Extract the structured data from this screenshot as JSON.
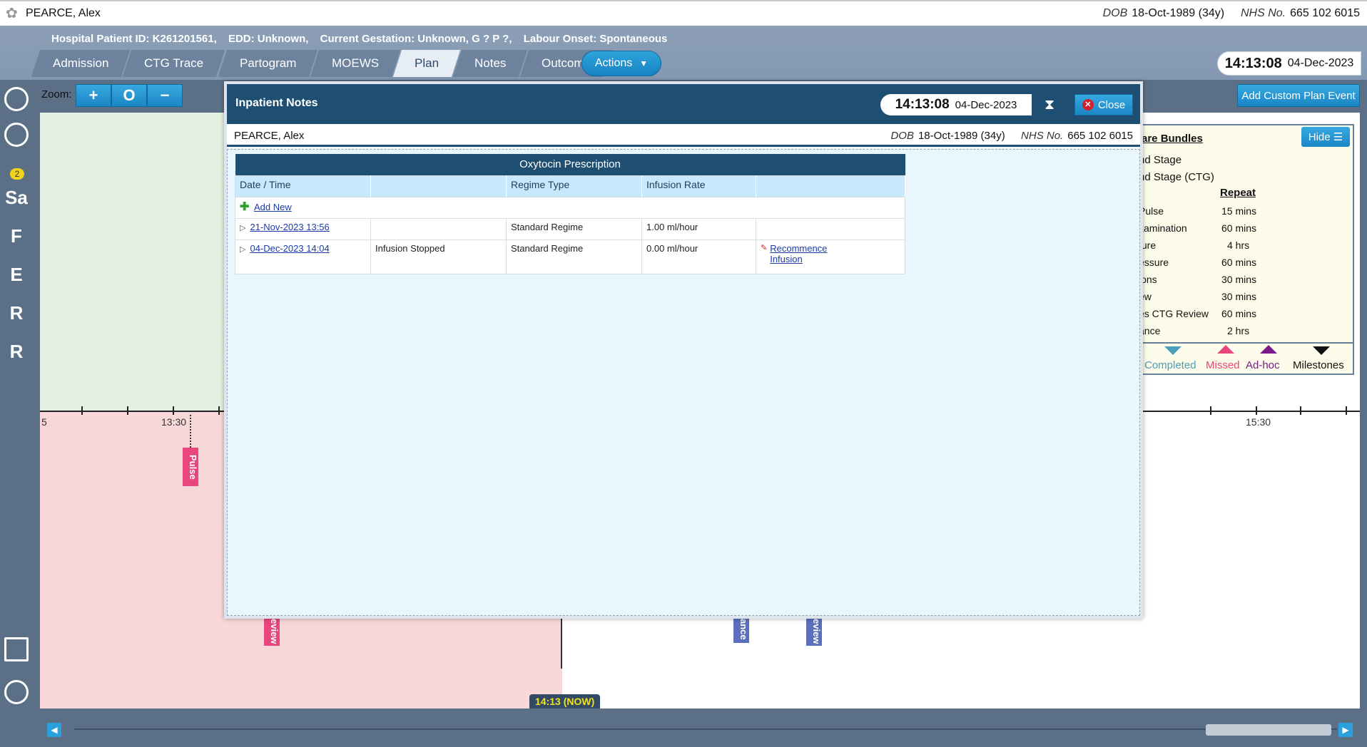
{
  "patient": {
    "name": "PEARCE, Alex",
    "dob_label": "DOB",
    "dob": "18-Oct-1989 (34y)",
    "nhs_label": "NHS No.",
    "nhs": "665 102 6015"
  },
  "header_info": {
    "hospital_id": "Hospital Patient ID: K261201561,",
    "edd": "EDD: Unknown,",
    "gestation": "Current Gestation: Unknown, G ? P ?,",
    "labour": "Labour Onset: Spontaneous"
  },
  "tabs": [
    {
      "label": "Admission"
    },
    {
      "label": "CTG Trace"
    },
    {
      "label": "Partogram"
    },
    {
      "label": "MOEWS"
    },
    {
      "label": "Plan"
    },
    {
      "label": "Notes"
    },
    {
      "label": "Outcome"
    }
  ],
  "actions_label": "Actions",
  "clock": {
    "time": "14:13:08",
    "date": "04-Dec-2023"
  },
  "rail": {
    "badge": "2",
    "letters": [
      "Sa",
      "F",
      "E",
      "R",
      "R"
    ]
  },
  "toolbar": {
    "zoom_label": "Zoom:",
    "zoom_in": "+",
    "zoom_reset": "O",
    "zoom_out": "−",
    "add_custom": "Add Custom Plan Event"
  },
  "timeline": {
    "tick_left_partial": "5",
    "tick_1330": "13:30",
    "tick_1530": "15:30",
    "tags": {
      "pulse": "Pulse",
      "review_pink": "eview",
      "ance_blue": "ance",
      "review_blue": "eview"
    },
    "now_label": "14:13 (NOW)"
  },
  "legend": {
    "title": "are Bundles",
    "hide": "Hide",
    "stage1": "nd Stage",
    "stage2": "nd Stage (CTG)",
    "repeat_header": "Repeat",
    "rows": [
      {
        "name": "Pulse",
        "repeat": "15 mins"
      },
      {
        "name": "xamination",
        "repeat": "60 mins"
      },
      {
        "name": "ture",
        "repeat": "4 hrs"
      },
      {
        "name": "essure",
        "repeat": "60 mins"
      },
      {
        "name": "ions",
        "repeat": "30 mins"
      },
      {
        "name": "ew",
        "repeat": "30 mins"
      },
      {
        "name": "es CTG Review",
        "repeat": "60 mins"
      },
      {
        "name": "ance",
        "repeat": "2 hrs"
      }
    ],
    "keys": {
      "completed": "Completed",
      "missed": "Missed",
      "adhoc": "Ad-hoc",
      "milestones": "Milestones"
    },
    "colors": {
      "completed": "#4aa0b8",
      "missed": "#e8467c",
      "adhoc": "#7a1a8a",
      "milestones": "#111111"
    }
  },
  "modal": {
    "title": "Inpatient Notes",
    "time": "14:13:08",
    "date": "04-Dec-2023",
    "close_label": "Close",
    "table": {
      "caption": "Oxytocin Prescription",
      "columns": [
        "Date / Time",
        "",
        "Regime Type",
        "Infusion Rate",
        ""
      ],
      "add_new": "Add New",
      "rows": [
        {
          "datetime": "21-Nov-2023 13:56",
          "status": "",
          "regime": "Standard Regime",
          "rate": "1.00 ml/hour",
          "action": ""
        },
        {
          "datetime": "04-Dec-2023 14:04",
          "status": "Infusion Stopped",
          "regime": "Standard Regime",
          "rate": "0.00 ml/hour",
          "action": "Recommence Infusion"
        }
      ]
    }
  }
}
